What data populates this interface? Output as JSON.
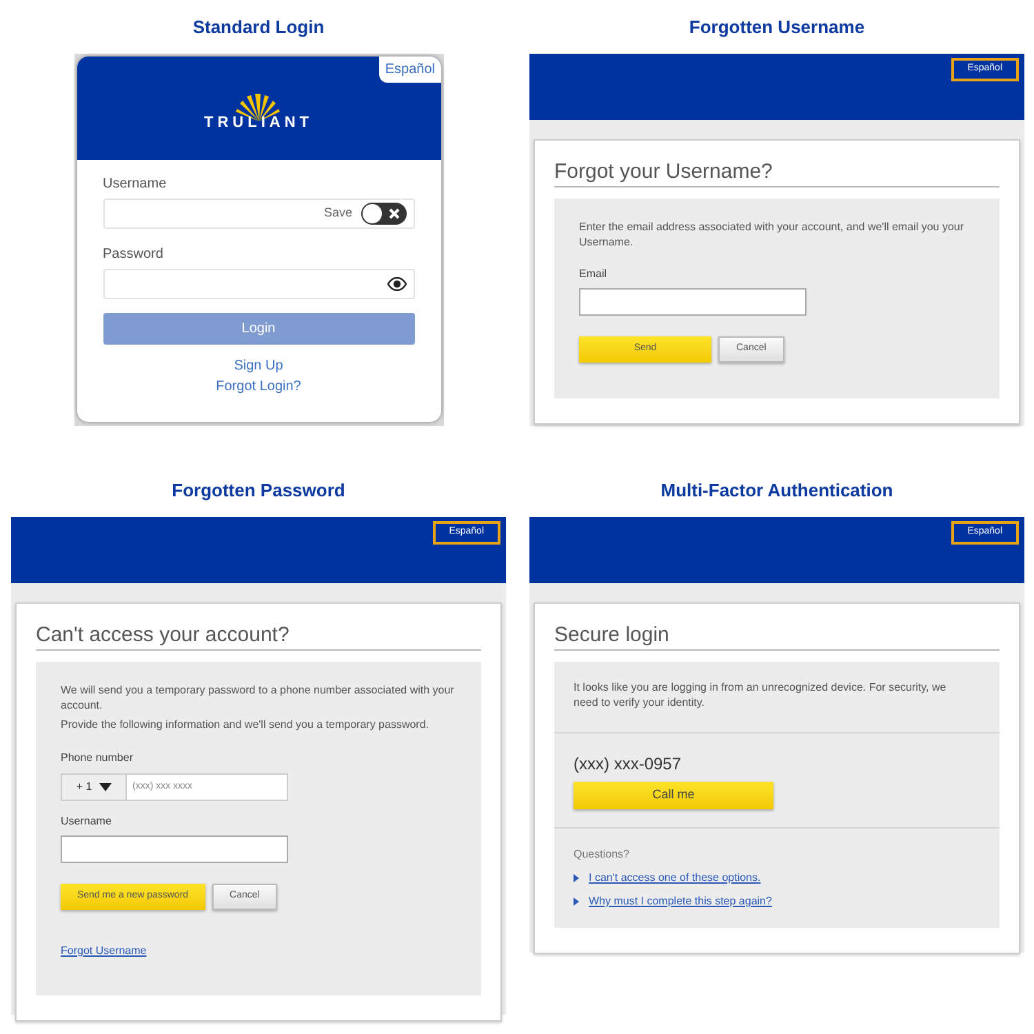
{
  "panels": [
    {
      "kind": "standard",
      "title": "Standard Login",
      "language_link": "Español",
      "logo": "TRULIANT",
      "fields": [
        {
          "kind": "save_toggle",
          "label": "Username",
          "toggle_label": "Save",
          "on": false
        },
        {
          "kind": "reveal",
          "label": "Password"
        }
      ],
      "login_button": {
        "label": "Login",
        "disabled": true
      },
      "links": [
        "Sign Up",
        "Forgot Login?"
      ]
    },
    {
      "kind": "form",
      "title": "Forgotten Username",
      "language_link": "Español",
      "heading": "Forgot your Username?",
      "sections": [
        {
          "items": [
            {
              "kind": "text",
              "text": "Enter the email address associated with your account, and we'll email you your Username."
            },
            {
              "kind": "field",
              "label": "Email"
            },
            {
              "kind": "buttons",
              "buttons": [
                {
                  "label": "Send",
                  "primary": true
                },
                {
                  "label": "Cancel",
                  "primary": false
                }
              ]
            }
          ]
        }
      ]
    },
    {
      "kind": "form",
      "title": "Forgotten Password",
      "language_link": "Español",
      "heading": "Can't access your account?",
      "sections": [
        {
          "items": [
            {
              "kind": "text",
              "text": "We will send you a temporary password to a phone number associated with your account."
            },
            {
              "kind": "text",
              "text": "Provide the following information and we'll send you a temporary password."
            },
            {
              "kind": "phone",
              "label": "Phone number",
              "code": "+ 1",
              "placeholder": "(xxx) xxx xxxx"
            },
            {
              "kind": "field",
              "label": "Username"
            },
            {
              "kind": "buttons",
              "buttons": [
                {
                  "label": "Send me a new password",
                  "primary": true
                },
                {
                  "label": "Cancel",
                  "primary": false
                }
              ]
            },
            {
              "kind": "link",
              "text": "Forgot Username"
            }
          ]
        }
      ]
    },
    {
      "kind": "form",
      "title": "Multi-Factor Authentication",
      "language_link": "Español",
      "heading": "Secure login",
      "sections": [
        {
          "items": [
            {
              "kind": "text",
              "text": "It looks like you are logging in from an unrecognized device. For security, we need to verify your identity."
            }
          ]
        },
        {
          "items": [
            {
              "kind": "phone_display",
              "text": "(xxx) xxx-0957"
            },
            {
              "kind": "wide_button",
              "label": "Call me"
            }
          ]
        },
        {
          "items": [
            {
              "kind": "label",
              "text": "Questions?"
            },
            {
              "kind": "arrow_link",
              "text": "I can't access one of these options."
            },
            {
              "kind": "arrow_link",
              "text": "Why must I complete this step again?"
            }
          ]
        }
      ]
    }
  ]
}
